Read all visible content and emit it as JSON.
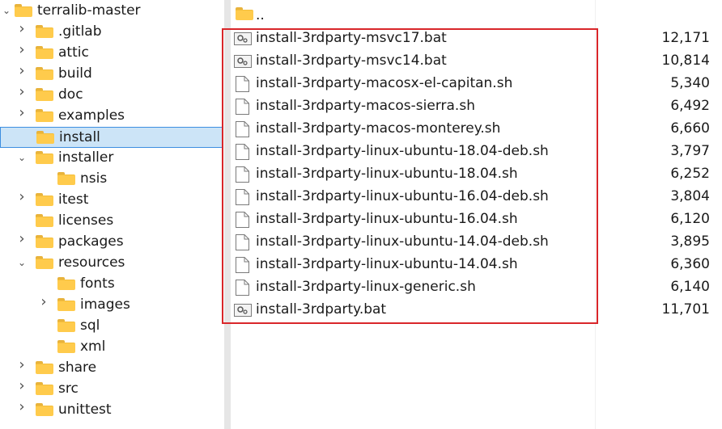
{
  "tree": {
    "root": "terralib-master",
    "items": [
      {
        "label": ".gitlab",
        "chevron": "right"
      },
      {
        "label": "attic",
        "chevron": "right"
      },
      {
        "label": "build",
        "chevron": "right"
      },
      {
        "label": "doc",
        "chevron": "right"
      },
      {
        "label": "examples",
        "chevron": "right"
      },
      {
        "label": "install",
        "chevron": "none",
        "selected": true
      },
      {
        "label": "installer",
        "chevron": "down"
      },
      {
        "label": "nsis",
        "chevron": "none",
        "child": true
      },
      {
        "label": "itest",
        "chevron": "right"
      },
      {
        "label": "licenses",
        "chevron": "none"
      },
      {
        "label": "packages",
        "chevron": "right"
      },
      {
        "label": "resources",
        "chevron": "down"
      },
      {
        "label": "fonts",
        "chevron": "none",
        "child": true
      },
      {
        "label": "images",
        "chevron": "right",
        "child": true
      },
      {
        "label": "sql",
        "chevron": "none",
        "child": true
      },
      {
        "label": "xml",
        "chevron": "none",
        "child": true
      },
      {
        "label": "share",
        "chevron": "right"
      },
      {
        "label": "src",
        "chevron": "right"
      },
      {
        "label": "unittest",
        "chevron": "right"
      }
    ]
  },
  "files": {
    "parent": "..",
    "items": [
      {
        "name": "install-3rdparty-msvc17.bat",
        "size": "12,171",
        "icon": "bat-file-icon"
      },
      {
        "name": "install-3rdparty-msvc14.bat",
        "size": "10,814",
        "icon": "bat-file-icon"
      },
      {
        "name": "install-3rdparty-macosx-el-capitan.sh",
        "size": "5,340",
        "icon": "file-icon"
      },
      {
        "name": "install-3rdparty-macos-sierra.sh",
        "size": "6,492",
        "icon": "file-icon"
      },
      {
        "name": "install-3rdparty-macos-monterey.sh",
        "size": "6,660",
        "icon": "file-icon"
      },
      {
        "name": "install-3rdparty-linux-ubuntu-18.04-deb.sh",
        "size": "3,797",
        "icon": "file-icon"
      },
      {
        "name": "install-3rdparty-linux-ubuntu-18.04.sh",
        "size": "6,252",
        "icon": "file-icon"
      },
      {
        "name": "install-3rdparty-linux-ubuntu-16.04-deb.sh",
        "size": "3,804",
        "icon": "file-icon"
      },
      {
        "name": "install-3rdparty-linux-ubuntu-16.04.sh",
        "size": "6,120",
        "icon": "file-icon"
      },
      {
        "name": "install-3rdparty-linux-ubuntu-14.04-deb.sh",
        "size": "3,895",
        "icon": "file-icon"
      },
      {
        "name": "install-3rdparty-linux-ubuntu-14.04.sh",
        "size": "6,360",
        "icon": "file-icon"
      },
      {
        "name": "install-3rdparty-linux-generic.sh",
        "size": "6,140",
        "icon": "file-icon"
      },
      {
        "name": "install-3rdparty.bat",
        "size": "11,701",
        "icon": "bat-file-icon"
      }
    ]
  },
  "colors": {
    "selection_bg": "#cce4f7",
    "selection_border": "#3d8ee0",
    "highlight_border": "#d9262a",
    "folder": "#ffcb4c"
  }
}
